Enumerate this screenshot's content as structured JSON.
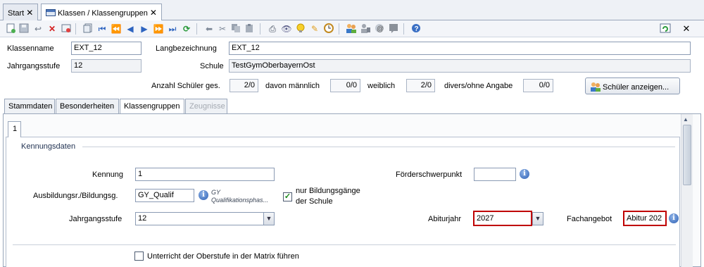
{
  "tabs": [
    {
      "label": "Start",
      "active": false
    },
    {
      "label": "Klassen / Klassengruppen",
      "active": true
    }
  ],
  "close_glyph": "✕",
  "toolbar": {
    "icons": [
      "new-icon",
      "save-icon",
      "undo-icon",
      "delete-icon",
      "cancel-icon",
      "copy-record-icon",
      "first-record-icon",
      "page-back-icon",
      "prev-record-icon",
      "next-record-icon",
      "page-forward-icon",
      "last-record-icon",
      "refresh-icon",
      "arrow-left-icon",
      "scissors-icon",
      "copy-icon",
      "paste-icon",
      "print-icon",
      "preview-icon",
      "hint-icon",
      "wand-icon",
      "clock-icon",
      "users-icon",
      "user-edit-icon",
      "at-icon",
      "note-icon",
      "help-icon"
    ],
    "right_icons": [
      "window-refresh-icon",
      "close-window-icon"
    ]
  },
  "header": {
    "klassenname_label": "Klassenname",
    "klassenname_value": "EXT_12",
    "langbezeichnung_label": "Langbezeichnung",
    "langbezeichnung_value": "EXT_12",
    "jahrgangsstufe_label": "Jahrgangsstufe",
    "jahrgangsstufe_value": "12",
    "schule_label": "Schule",
    "schule_value": "TestGymOberbayernOst",
    "anzahl_label": "Anzahl Schüler ges.",
    "anzahl_value": "2/0",
    "maennlich_label": "davon männlich",
    "maennlich_value": "0/0",
    "weiblich_label": "weiblich",
    "weiblich_value": "2/0",
    "divers_label": "divers/ohne Angabe",
    "divers_value": "0/0",
    "schueler_button": "Schüler anzeigen..."
  },
  "subtabs": [
    {
      "label": "Stammdaten",
      "state": "normal"
    },
    {
      "label": "Besonderheiten",
      "state": "normal"
    },
    {
      "label": "Klassengruppen",
      "state": "active"
    },
    {
      "label": "Zeugnisse",
      "state": "disabled"
    }
  ],
  "group_tab": "1",
  "kennungsdaten": {
    "section_title": "Kennungsdaten",
    "kennung_label": "Kennung",
    "kennung_value": "1",
    "ausbildung_label": "Ausbildungsr./Bildungsg.",
    "ausbildung_value": "GY_Qualif",
    "ausbildung_hint_line1": "GY",
    "ausbildung_hint_line2": "Qualifikationsphas...",
    "nur_bildungsgaenge_line1": "nur Bildungsgänge",
    "nur_bildungsgaenge_line2": "der Schule",
    "nur_bildungsgaenge_checked": true,
    "jahrgangsstufe_label": "Jahrgangsstufe",
    "jahrgangsstufe_value": "12",
    "foerderschwerpunkt_label": "Förderschwerpunkt",
    "foerderschwerpunkt_value": "",
    "abiturjahr_label": "Abiturjahr",
    "abiturjahr_value": "2027",
    "fachangebot_label": "Fachangebot",
    "fachangebot_value": "Abitur 202",
    "matrix_label": "Unterricht der Oberstufe in der Matrix führen",
    "matrix_checked": false
  },
  "colors": {
    "highlight": "#c00000",
    "tab_border": "#9aa7bb"
  }
}
